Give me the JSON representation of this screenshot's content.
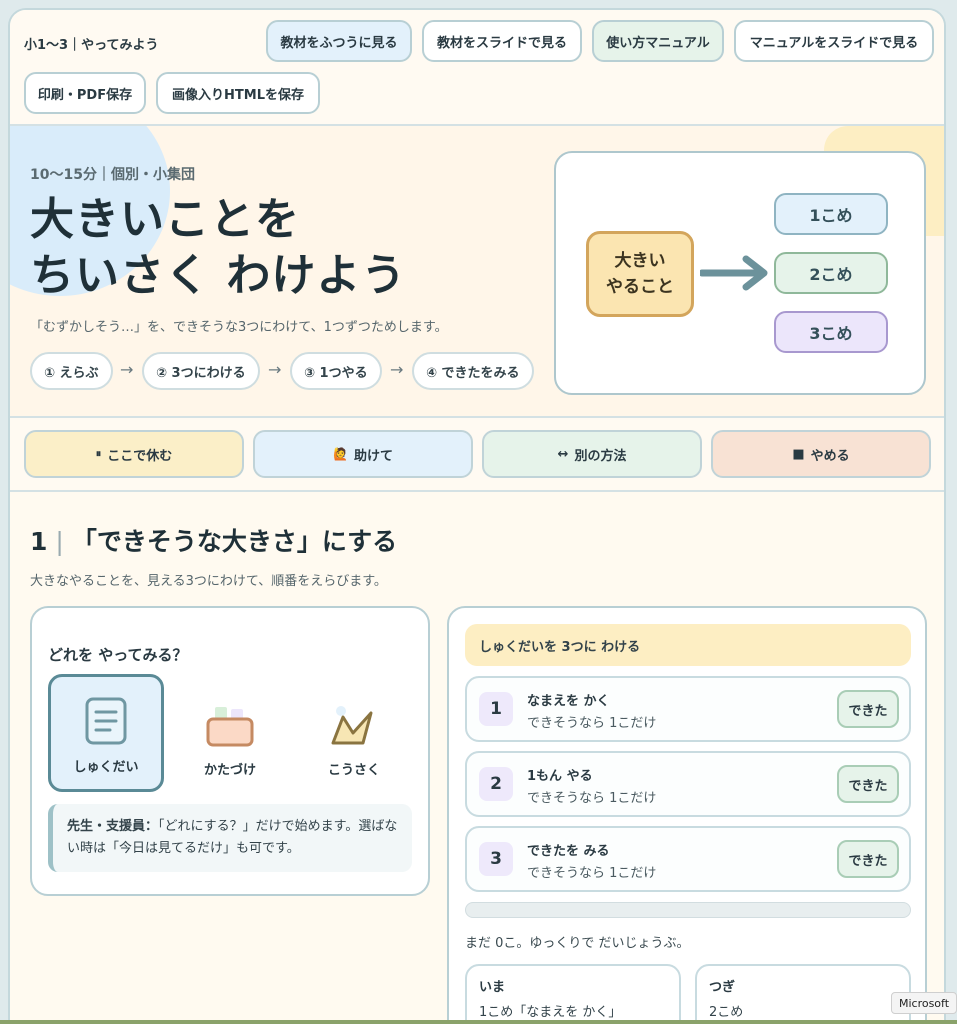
{
  "toolbar": {
    "brand": "小1〜3｜やってみよう",
    "buttons": [
      "教材をふつうに見る",
      "教材をスライドで見る",
      "使い方マニュアル",
      "マニュアルをスライドで見る",
      "印刷・PDF保存",
      "画像入りHTMLを保存"
    ]
  },
  "hero": {
    "meta": "10〜15分｜個別・小集団",
    "title_line1": "大きいことを",
    "title_line2": "ちいさく わけよう",
    "lead": "「むずかしそう…」を、できそうな3つにわけて、1つずつためします。",
    "steps": [
      "① えらぶ",
      "② 3つにわける",
      "③ 1つやる",
      "④ できたをみる"
    ],
    "arrow": "→",
    "diagram": {
      "big_task_line1": "大きい",
      "big_task_line2": "やること",
      "parts": [
        "1こめ",
        "2こめ",
        "3こめ"
      ]
    }
  },
  "actions": [
    {
      "icon": "⏸",
      "label": "ここで休む",
      "color": "#fbefc8"
    },
    {
      "icon": "🙋",
      "label": "助けて",
      "color": "#e3f1fb"
    },
    {
      "icon": "↔",
      "label": "別の方法",
      "color": "#e6f3ea"
    },
    {
      "icon": "■",
      "label": "やめる",
      "color": "#f8e2d4"
    }
  ],
  "section": {
    "number": "1",
    "title": "「できそうな大きさ」にする",
    "lead": "大きなやることを、見える3つにわけて、順番をえらびます。"
  },
  "choose": {
    "question": "どれを やってみる？",
    "options": [
      {
        "label": "しゅくだい",
        "icon": "notebook-icon",
        "selected": true
      },
      {
        "label": "かたづけ",
        "icon": "box-icon",
        "selected": false
      },
      {
        "label": "こうさく",
        "icon": "crown-craft-icon",
        "selected": false
      }
    ],
    "note_bold": "先生・支援員：",
    "note_text": "「どれにする？」だけで始めます。選ばない時は「今日は見てるだけ」も可です。"
  },
  "split": {
    "banner": "しゅくだいを 3つに わける",
    "rows": [
      {
        "n": "1",
        "title": "なまえを かく",
        "sub": "できそうなら 1こだけ",
        "done": "できた"
      },
      {
        "n": "2",
        "title": "1もん やる",
        "sub": "できそうなら 1こだけ",
        "done": "できた"
      },
      {
        "n": "3",
        "title": "できたを みる",
        "sub": "できそうなら 1こだけ",
        "done": "できた"
      }
    ],
    "progress": 0,
    "progress_text": "まだ 0こ。ゆっくりで だいじょうぶ。",
    "now_label": "いま",
    "now_value": "1こめ「なまえを かく」",
    "next_label": "つぎ",
    "next_value": "2こめ"
  },
  "overlay": {
    "tag": "Microsoft"
  }
}
